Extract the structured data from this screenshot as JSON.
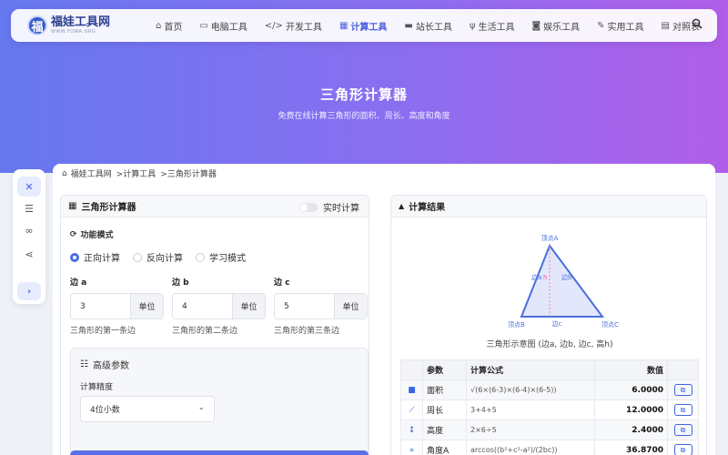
{
  "logo": {
    "mark": "福",
    "title": "福娃工具网",
    "subtitle": "WWW.FUWA.ORG"
  },
  "nav": [
    {
      "icon": "⌂",
      "label": "首页"
    },
    {
      "icon": "▭",
      "label": "电脑工具"
    },
    {
      "icon": "</>",
      "label": "开发工具"
    },
    {
      "icon": "▦",
      "label": "计算工具",
      "active": true
    },
    {
      "icon": "▬",
      "label": "站长工具"
    },
    {
      "icon": "ψ",
      "label": "生活工具"
    },
    {
      "icon": "◙",
      "label": "娱乐工具"
    },
    {
      "icon": "✎",
      "label": "实用工具"
    },
    {
      "icon": "▤",
      "label": "对照表"
    }
  ],
  "hero": {
    "title": "三角形计算器",
    "subtitle": "免费在线计算三角形的面积、周长、高度和角度"
  },
  "breadcrumb": {
    "home": "福娃工具网",
    "section": ">计算工具",
    "current": ">三角形计算器"
  },
  "calculator": {
    "title": "三角形计算器",
    "realtime_label": "实时计算",
    "mode_title": "功能模式",
    "modes": [
      "正向计算",
      "反向计算",
      "学习模式"
    ],
    "selected_mode": "正向计算",
    "sides": [
      {
        "label": "边 a",
        "value": "3",
        "unit": "单位",
        "help": "三角形的第一条边"
      },
      {
        "label": "边 b",
        "value": "4",
        "unit": "单位",
        "help": "三角形的第二条边"
      },
      {
        "label": "边 c",
        "value": "5",
        "unit": "单位",
        "help": "三角形的第三条边"
      }
    ],
    "advanced": {
      "title": "高级参数",
      "precision_label": "计算精度",
      "precision_value": "4位小数"
    }
  },
  "results": {
    "title": "计算结果",
    "diagram": {
      "vertex_a": "顶点A",
      "vertex_b": "顶点B",
      "vertex_c": "顶点C",
      "side_a": "边a",
      "side_b": "边b",
      "side_c": "边c",
      "height": "h"
    },
    "caption": "三角形示意图 (边a, 边b, 边c, 高h)",
    "headers": {
      "param": "参数",
      "formula": "计算公式",
      "value": "数值"
    },
    "rows": [
      {
        "icon": "■",
        "name": "面积",
        "formula": "√(6×(6-3)×(6-4)×(6-5))",
        "value": "6.0000"
      },
      {
        "icon": "⟋",
        "name": "周长",
        "formula": "3+4+5",
        "value": "12.0000"
      },
      {
        "icon": "↕",
        "name": "高度",
        "formula": "2×6÷5",
        "value": "2.4000"
      },
      {
        "icon": "»",
        "name": "角度A",
        "formula": "arccos((b²+c²-a²)/(2bc))",
        "value": "36.8700"
      }
    ]
  }
}
